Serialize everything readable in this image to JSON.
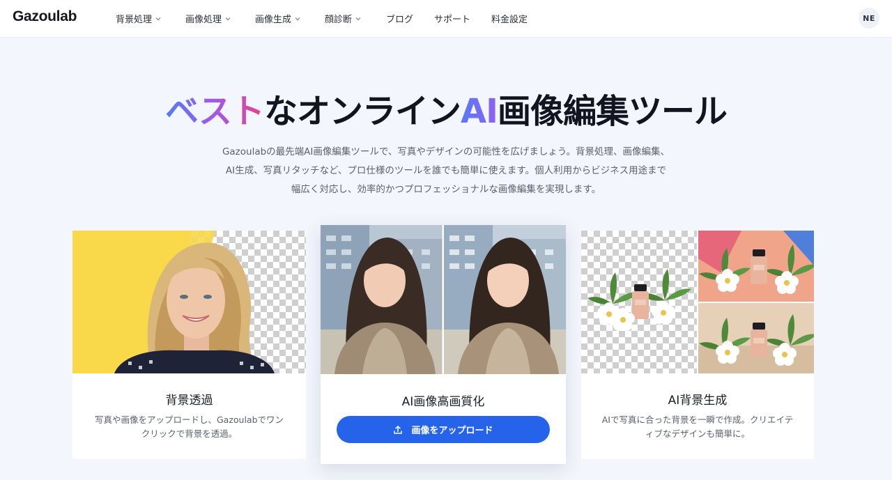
{
  "header": {
    "logo": "Gazoulab",
    "nav": [
      {
        "label": "背景処理",
        "dropdown": true
      },
      {
        "label": "画像処理",
        "dropdown": true
      },
      {
        "label": "画像生成",
        "dropdown": true
      },
      {
        "label": "顔診断",
        "dropdown": true
      },
      {
        "label": "ブログ",
        "dropdown": false
      },
      {
        "label": "サポート",
        "dropdown": false
      },
      {
        "label": "料金設定",
        "dropdown": false
      }
    ],
    "avatar": "NE"
  },
  "hero": {
    "title_part1": "ベスト",
    "title_part2": "なオンライン",
    "title_part3": "AI",
    "title_part4": "画像編集ツール",
    "description_lines": [
      "Gazoulabの最先端AI画像編集ツールで、写真やデザインの可能性を広げましょう。背景処理、画像編集、",
      "AI生成、写真リタッチなど、プロ仕様のツールを誰でも簡単に使えます。個人利用からビジネス用途まで",
      "幅広く対応し、効率的かつプロフェッショナルな画像編集を実現します。"
    ]
  },
  "cards": [
    {
      "title": "背景透過",
      "description_lines": [
        "写真や画像をアップロードし、Gazoulabでワン",
        "クリックで背景を透過。"
      ]
    },
    {
      "title": "AI画像高画質化",
      "button_label": "画像をアップロード"
    },
    {
      "title": "AI背景生成",
      "description_lines": [
        "AIで写真に合った背景を一瞬で作成。クリエイテ",
        "ィブなデザインも簡単に。"
      ]
    }
  ],
  "colors": {
    "accent": "#2563eb",
    "background": "#f3f6fc",
    "title_gradient": [
      "#4f7cf5",
      "#9b5cf0",
      "#e6418f"
    ]
  },
  "icons": {
    "nav_dropdown": "chevron-down-icon",
    "upload": "upload-icon"
  }
}
